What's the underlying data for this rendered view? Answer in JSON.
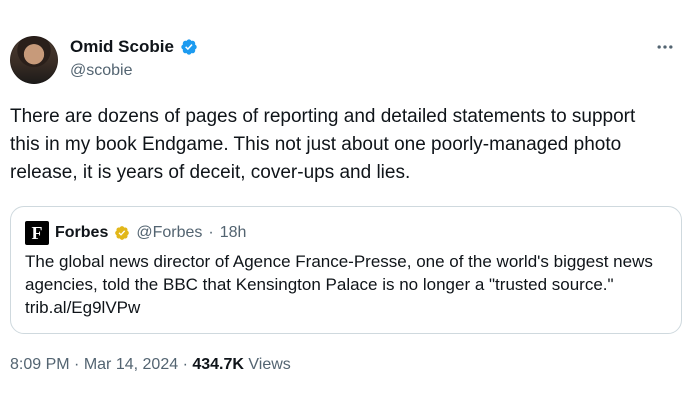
{
  "author": {
    "name": "Omid Scobie",
    "handle": "@scobie"
  },
  "tweet": {
    "text": "There are dozens of pages of reporting and detailed statements to support this in my book Endgame. This not just about one poorly-managed photo release, it is years of deceit, cover-ups and lies."
  },
  "quote": {
    "logo_letter": "F",
    "name": "Forbes",
    "handle": "@Forbes",
    "time": "18h",
    "text": "The global news director of Agence France-Presse, one of the world's biggest news agencies, told the BBC that Kensington Palace is no longer a \"trusted source.\" trib.al/Eg9lVPw"
  },
  "meta": {
    "time": "8:09 PM",
    "date": "Mar 14, 2024",
    "views_count": "434.7K",
    "views_label": "Views"
  },
  "icons": {
    "verified_badge": "blue-check-icon",
    "gold_badge": "gold-check-icon",
    "more": "more-icon"
  },
  "colors": {
    "verified_blue": "#1d9bf0",
    "gold": "#e2b719",
    "muted": "#536471",
    "border": "#cfd9de"
  }
}
